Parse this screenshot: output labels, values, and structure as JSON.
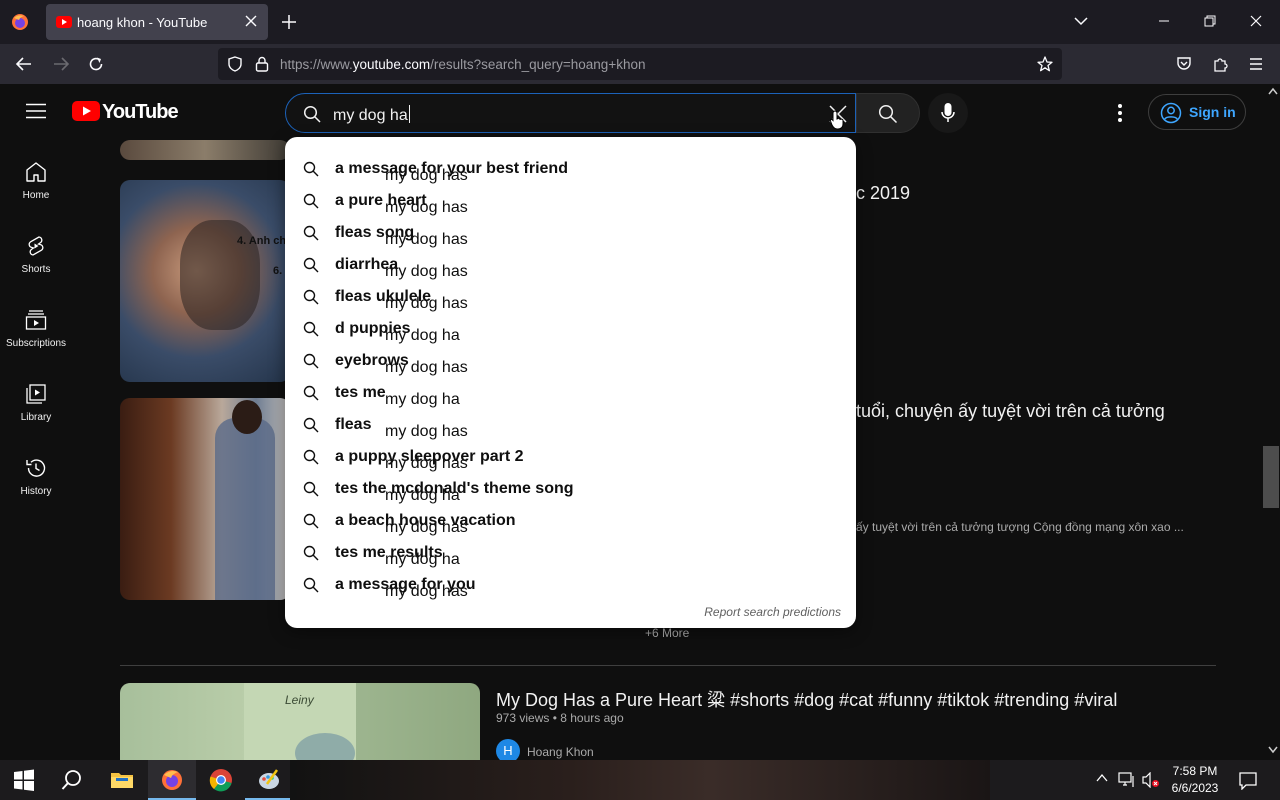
{
  "browser": {
    "tab_title": "hoang khon - YouTube",
    "url_prefix": "https://www.",
    "url_domain": "youtube.com",
    "url_rest": "/results?search_query=hoang+khon"
  },
  "youtube": {
    "logo_text": "YouTube",
    "search": {
      "query": "my dog ha"
    },
    "sign_in_label": "Sign in",
    "guide": [
      {
        "label": "Home",
        "icon": "home-icon"
      },
      {
        "label": "Shorts",
        "icon": "shorts-icon"
      },
      {
        "label": "Subscriptions",
        "icon": "subscriptions-icon"
      },
      {
        "label": "Library",
        "icon": "library-icon"
      },
      {
        "label": "History",
        "icon": "history-icon"
      }
    ],
    "suggestions": [
      {
        "typed": "my dog has",
        "completion": " a message for your best friend"
      },
      {
        "typed": "my dog has",
        "completion": " a pure heart"
      },
      {
        "typed": "my dog has",
        "completion": " fleas song"
      },
      {
        "typed": "my dog has",
        "completion": " diarrhea"
      },
      {
        "typed": "my dog has",
        "completion": " fleas ukulele"
      },
      {
        "typed": "my dog ha",
        "completion": "d puppies"
      },
      {
        "typed": "my dog has",
        "completion": " eyebrows"
      },
      {
        "typed": "my dog ha",
        "completion": "tes me"
      },
      {
        "typed": "my dog has",
        "completion": " fleas"
      },
      {
        "typed": "my dog has",
        "completion": " a puppy sleepover part 2"
      },
      {
        "typed": "my dog ha",
        "completion": "tes the mcdonald's theme song"
      },
      {
        "typed": "my dog has",
        "completion": " a beach house vacation"
      },
      {
        "typed": "my dog ha",
        "completion": "tes me results"
      },
      {
        "typed": "my dog has",
        "completion": " a message for you"
      }
    ],
    "report_label": "Report search predictions",
    "results": {
      "video1_title_fragment": "c 2019",
      "video1_thumb_text": [
        "4. Anh ch",
        "6."
      ],
      "video2_title_fragment": "tuổi, chuyện ấy tuyệt vời trên cả tưởng",
      "video2_desc_fragment": "ấy tuyệt vời trên cả tưởng tượng Cộng đồng mạng xôn xao ...",
      "more_label": "+6 More",
      "video3": {
        "title": "My Dog Has a Pure Heart 粱 #shorts #dog #cat #funny #tiktok #trending #viral",
        "views": "973 views",
        "age": "8 hours ago",
        "channel": "Hoang Khon",
        "channel_initial": "H",
        "thumb_text": "Leiny"
      }
    }
  },
  "taskbar": {
    "time": "7:58 PM",
    "date": "6/6/2023"
  },
  "colors": {
    "yt_red": "#ff0000",
    "link_blue": "#3ea6ff",
    "focus_blue": "#1c62b9"
  }
}
